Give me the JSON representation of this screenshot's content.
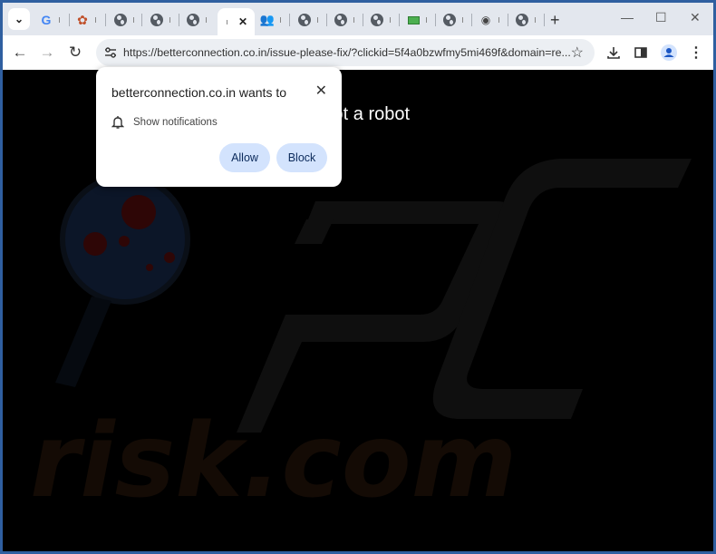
{
  "browser": {
    "tabs": [
      {
        "icon": "google-icon",
        "label": ""
      },
      {
        "icon": "colorful-favicon-icon",
        "label": ""
      },
      {
        "icon": "globe-icon",
        "label": ""
      },
      {
        "icon": "globe-icon",
        "label": ""
      },
      {
        "icon": "globe-icon",
        "label": ""
      },
      {
        "icon": "blank-icon",
        "label": "",
        "active": true
      },
      {
        "icon": "people-icon",
        "label": ""
      },
      {
        "icon": "globe-icon",
        "label": ""
      },
      {
        "icon": "globe-icon",
        "label": ""
      },
      {
        "icon": "globe-icon",
        "label": ""
      },
      {
        "icon": "laptop-icon",
        "label": ""
      },
      {
        "icon": "globe-icon",
        "label": ""
      },
      {
        "icon": "satellite-icon",
        "label": ""
      },
      {
        "icon": "globe-icon",
        "label": ""
      }
    ],
    "tab_search_glyph": "⌄",
    "active_tab_close": "✕",
    "new_tab_glyph": "+",
    "window_controls": {
      "minimize": "—",
      "maximize": "☐",
      "close": "✕"
    },
    "nav": {
      "back": "←",
      "forward": "→",
      "reload": "↻"
    },
    "url": "https://betterconnection.co.in/issue-please-fix/?clickid=5f4a0bzwfmy5mi469f&domain=re...",
    "bookmark_glyph": "☆",
    "menu_glyph": "⋮"
  },
  "page": {
    "message": "m that you are not a robot",
    "watermark_text": "PC risk.com"
  },
  "permission_popup": {
    "title": "betterconnection.co.in wants to",
    "close_glyph": "✕",
    "permission_label": "Show notifications",
    "allow_label": "Allow",
    "block_label": "Block"
  },
  "colors": {
    "frame_border": "#2f5fa0",
    "tabstrip_bg": "#e3e7ee",
    "omnibox_bg": "#eceff3",
    "button_bg": "#d3e3fd",
    "page_bg": "#000000"
  }
}
